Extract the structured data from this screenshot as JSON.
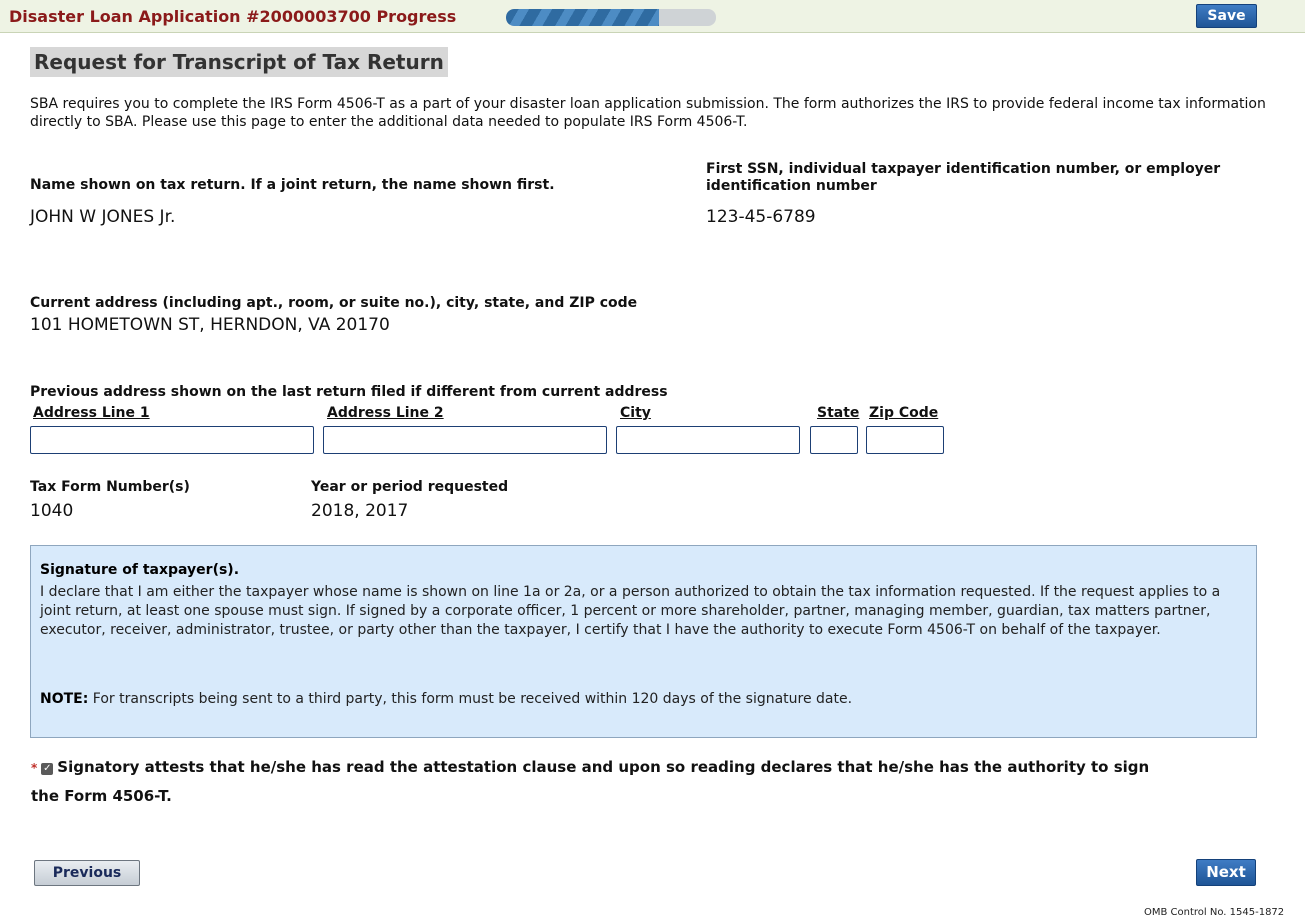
{
  "header": {
    "app_title": "Disaster Loan Application #2000003700 Progress",
    "progress_fraction": 0.73,
    "save_label": "Save"
  },
  "page_title": "Request for Transcript of Tax Return",
  "intro": "SBA requires you to complete the IRS Form 4506-T as a part of your disaster loan application submission. The form authorizes the IRS to provide federal income tax information directly to SBA. Please use this page to enter the additional data needed to populate IRS Form 4506-T.",
  "taxpayer": {
    "name_label": "Name shown on tax return. If a joint return, the name shown first.",
    "name_value": "JOHN W JONES Jr.",
    "ssn_label": "First SSN, individual taxpayer identification number, or employer identification number",
    "ssn_value": "123-45-6789"
  },
  "current_address": {
    "label": "Current address (including apt., room, or suite no.), city, state, and ZIP code",
    "value": "101 HOMETOWN ST, HERNDON, VA 20170"
  },
  "previous_address": {
    "label": "Previous address shown on the last return filed if different from current address",
    "fields": {
      "line1": {
        "label": "Address Line 1",
        "value": ""
      },
      "line2": {
        "label": "Address Line 2",
        "value": ""
      },
      "city": {
        "label": "City",
        "value": ""
      },
      "state": {
        "label": "State",
        "value": ""
      },
      "zip": {
        "label": "Zip Code",
        "value": ""
      }
    }
  },
  "tax_form": {
    "form_label": "Tax Form Number(s)",
    "form_value": "1040",
    "year_label": "Year or period requested",
    "year_value": "2018, 2017"
  },
  "signature": {
    "title": "Signature of taxpayer(s).",
    "body": "I declare that I am either the taxpayer whose name is shown on line 1a or 2a, or a person authorized to obtain the tax information requested. If the request applies to a joint return, at least one spouse must sign. If signed by a corporate officer, 1 percent or more shareholder, partner, managing member, guardian, tax matters partner, executor, receiver, administrator, trustee, or party other than the taxpayer, I certify that I have the authority to execute Form 4506-T on behalf of the taxpayer.",
    "note_label": "NOTE:",
    "note_text": " For transcripts being sent to a third party, this form must be received within 120 days of the signature date."
  },
  "attestation": {
    "required_marker": "*",
    "checked": true,
    "text": "Signatory attests that he/she has read the attestation clause and upon so reading declares that he/she has the authority to sign the Form 4506-T."
  },
  "nav": {
    "previous_label": "Previous",
    "next_label": "Next"
  },
  "footer": {
    "omb": "OMB Control No. 1545-1872"
  }
}
